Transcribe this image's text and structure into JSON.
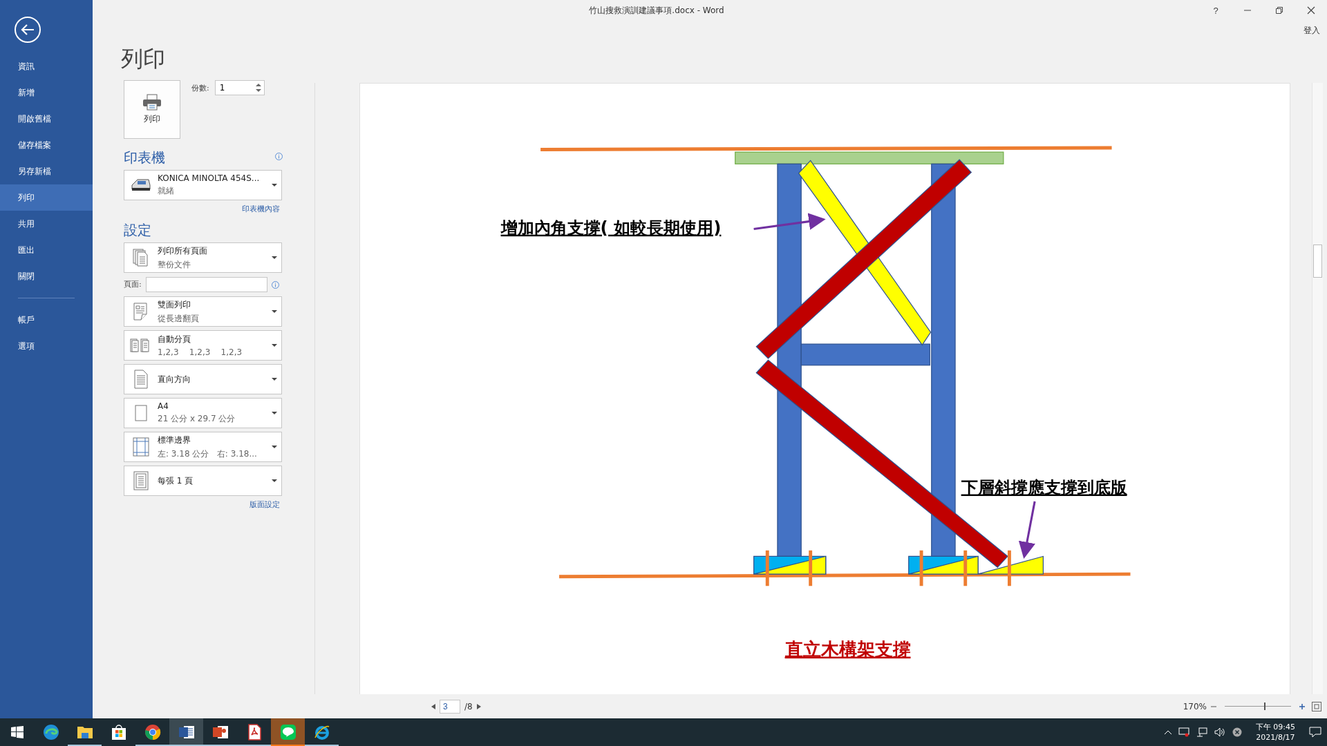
{
  "window": {
    "title": "竹山搜救演訓建議事項.docx - Word",
    "help": "?",
    "sign_in": "登入"
  },
  "sidebar": {
    "items": [
      {
        "label": "資訊",
        "selected": false
      },
      {
        "label": "新增",
        "selected": false
      },
      {
        "label": "開啟舊檔",
        "selected": false
      },
      {
        "label": "儲存檔案",
        "selected": false
      },
      {
        "label": "另存新檔",
        "selected": false
      },
      {
        "label": "列印",
        "selected": true
      },
      {
        "label": "共用",
        "selected": false
      },
      {
        "label": "匯出",
        "selected": false
      },
      {
        "label": "關閉",
        "selected": false
      }
    ],
    "bottom_items": [
      {
        "label": "帳戶",
        "selected": false
      },
      {
        "label": "選項",
        "selected": false
      }
    ]
  },
  "print": {
    "heading": "列印",
    "print_button": "列印",
    "copies_label": "份數:",
    "copies": "1",
    "printer_heading": "印表機",
    "printer": {
      "name": "KONICA MINOLTA 454S...",
      "status": "就緒"
    },
    "printer_properties": "印表機內容",
    "settings_heading": "設定",
    "settings": [
      {
        "kind": "dropdown",
        "title": "列印所有頁面",
        "subtitle": "整份文件"
      },
      {
        "kind": "pages_field",
        "label": "頁面:"
      },
      {
        "kind": "dropdown",
        "title": "雙面列印",
        "subtitle": "從長邊翻頁"
      },
      {
        "kind": "dropdown",
        "title": "自動分頁",
        "subtitle": "1,2,3    1,2,3    1,2,3"
      },
      {
        "kind": "dropdown",
        "title": "直向方向"
      },
      {
        "kind": "dropdown",
        "title": "A4",
        "subtitle": "21 公分 x 29.7 公分"
      },
      {
        "kind": "dropdown",
        "title": "標準邊界",
        "subtitle": "左: 3.18 公分   右: 3.18..."
      },
      {
        "kind": "dropdown",
        "title": "每張 1 頁"
      }
    ],
    "page_setup": "版面設定"
  },
  "preview": {
    "labels": [
      "增加內角支撐(  如較長期使用)",
      "下層斜撐應支撐到底版"
    ],
    "caption": "直立木構架支撐",
    "page": "3",
    "page_total": "/8",
    "zoom": "170%",
    "zoom_slider": {
      "level": 0.59
    }
  },
  "taskbar": {
    "apps": [
      {
        "kind": "edge",
        "selected": false,
        "attention": false,
        "running": false
      },
      {
        "kind": "explorer",
        "selected": false,
        "attention": false,
        "running": true
      },
      {
        "kind": "store",
        "selected": false,
        "attention": false,
        "running": false
      },
      {
        "kind": "chrome",
        "selected": false,
        "attention": false,
        "running": true
      },
      {
        "kind": "word",
        "selected": true,
        "attention": false,
        "running": true
      },
      {
        "kind": "powerpoint",
        "selected": false,
        "attention": false,
        "running": true
      },
      {
        "kind": "pdf",
        "selected": false,
        "attention": false,
        "running": true
      },
      {
        "kind": "line",
        "selected": false,
        "attention": true,
        "running": true
      },
      {
        "kind": "ie",
        "selected": false,
        "attention": false,
        "running": true
      }
    ],
    "time": "下午 09:45",
    "date": "2021/8/17"
  }
}
